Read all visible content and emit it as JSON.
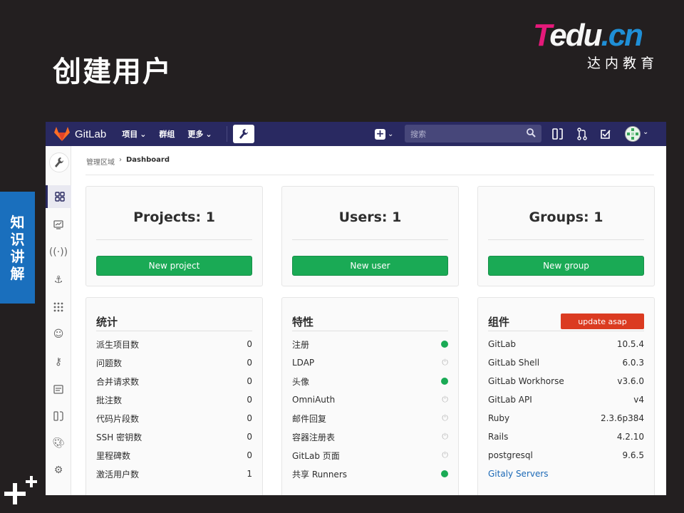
{
  "slide": {
    "title": "创建用户",
    "logo_main_a": "T",
    "logo_main_b": "edu",
    "logo_main_c": ".cn",
    "logo_sub": "达内教育",
    "side_tab": [
      "知",
      "识",
      "讲",
      "解"
    ]
  },
  "navbar": {
    "brand": "GitLab",
    "menus": [
      "项目",
      "群组",
      "更多"
    ],
    "search_placeholder": "搜索",
    "colors": {
      "bg": "#292961"
    }
  },
  "breadcrumb": {
    "parent": "管理区域",
    "current": "Dashboard"
  },
  "summary_cards": [
    {
      "title": "Projects: 1",
      "button": "New project"
    },
    {
      "title": "Users: 1",
      "button": "New user"
    },
    {
      "title": "Groups: 1",
      "button": "New group"
    }
  ],
  "stats": {
    "title": "统计",
    "rows": [
      {
        "label": "派生项目数",
        "value": "0"
      },
      {
        "label": "问题数",
        "value": "0"
      },
      {
        "label": "合并请求数",
        "value": "0"
      },
      {
        "label": "批注数",
        "value": "0"
      },
      {
        "label": "代码片段数",
        "value": "0"
      },
      {
        "label": "SSH 密钥数",
        "value": "0"
      },
      {
        "label": "里程碑数",
        "value": "0"
      },
      {
        "label": "激活用户数",
        "value": "1"
      }
    ]
  },
  "features": {
    "title": "特性",
    "rows": [
      {
        "label": "注册",
        "enabled": true
      },
      {
        "label": "LDAP",
        "enabled": false
      },
      {
        "label": "头像",
        "enabled": true
      },
      {
        "label": "OmniAuth",
        "enabled": false
      },
      {
        "label": "邮件回复",
        "enabled": false
      },
      {
        "label": "容器注册表",
        "enabled": false
      },
      {
        "label": "GitLab 页面",
        "enabled": false
      },
      {
        "label": "共享 Runners",
        "enabled": true
      }
    ]
  },
  "components": {
    "title": "组件",
    "badge": "update asap",
    "rows": [
      {
        "label": "GitLab",
        "value": "10.5.4"
      },
      {
        "label": "GitLab Shell",
        "value": "6.0.3"
      },
      {
        "label": "GitLab Workhorse",
        "value": "v3.6.0"
      },
      {
        "label": "GitLab API",
        "value": "v4"
      },
      {
        "label": "Ruby",
        "value": "2.3.6p384"
      },
      {
        "label": "Rails",
        "value": "4.2.10"
      },
      {
        "label": "postgresql",
        "value": "9.6.5"
      }
    ],
    "link": "Gitaly Servers"
  }
}
